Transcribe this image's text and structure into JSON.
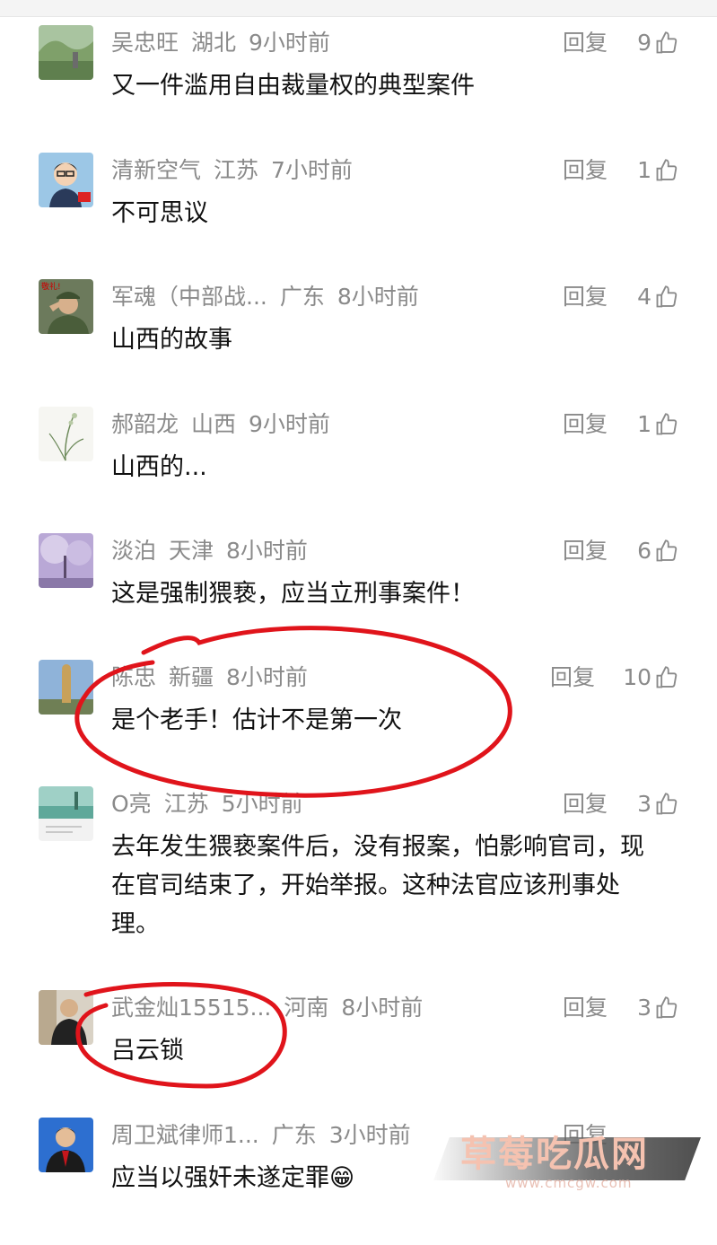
{
  "comments": [
    {
      "user": "吴忠旺",
      "region": "湖北",
      "time": "9小时前",
      "reply": "回复",
      "likes": "9",
      "text": "又一件滥用自由裁量权的典型案件",
      "avatar": "landscape-avatar"
    },
    {
      "user": "清新空气",
      "region": "江苏",
      "time": "7小时前",
      "reply": "回复",
      "likes": "1",
      "text": "不可思议",
      "avatar": "cartoon-man-avatar"
    },
    {
      "user": "军魂（中部战...",
      "region": "广东",
      "time": "8小时前",
      "reply": "回复",
      "likes": "4",
      "text": "山西的故事",
      "avatar": "soldier-salute-avatar"
    },
    {
      "user": "郝韶龙",
      "region": "山西",
      "time": "9小时前",
      "reply": "回复",
      "likes": "1",
      "text": "山西的...",
      "avatar": "orchid-avatar"
    },
    {
      "user": "淡泊",
      "region": "天津",
      "time": "8小时前",
      "reply": "回复",
      "likes": "6",
      "text": "这是强制猥亵，应当立刑事案件！",
      "avatar": "purple-tree-avatar"
    },
    {
      "user": "陈忠",
      "region": "新疆",
      "time": "8小时前",
      "reply": "回复",
      "likes": "10",
      "text": "是个老手！估计不是第一次",
      "avatar": "statue-avatar"
    },
    {
      "user": "O亮",
      "region": "江苏",
      "time": "5小时前",
      "reply": "回复",
      "likes": "3",
      "text": "去年发生猥亵案件后，没有报案，怕影响官司，现在官司结束了，开始举报。这种法官应该刑事处理。",
      "avatar": "lake-avatar"
    },
    {
      "user": "武金灿15515...",
      "region": "河南",
      "time": "8小时前",
      "reply": "回复",
      "likes": "3",
      "text": "吕云锁",
      "avatar": "person-avatar"
    },
    {
      "user": "周卫斌律师1...",
      "region": "广东",
      "time": "3小时前",
      "reply": "回复",
      "likes": "",
      "text": "应当以强奸未遂定罪😁",
      "avatar": "lawyer-avatar"
    }
  ],
  "watermark": {
    "title": "草莓吃瓜网",
    "url": "www.cmcgw.com"
  },
  "colors": {
    "meta": "#8a8a8a",
    "text": "#111111",
    "annotation": "#e0141b"
  }
}
